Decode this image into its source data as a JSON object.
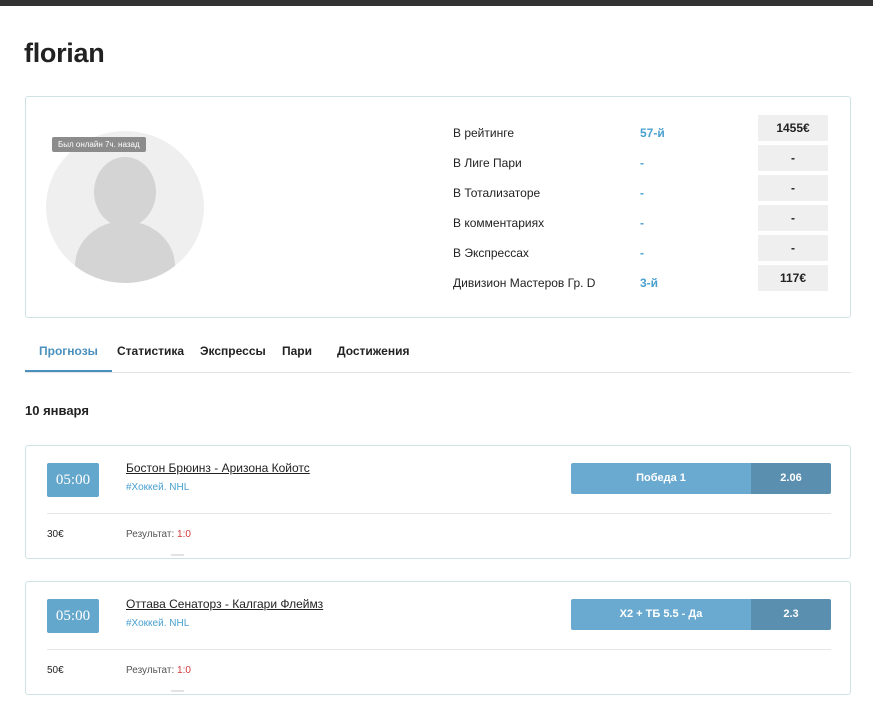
{
  "profile": {
    "username": "florian",
    "online_status": "Был онлайн 7ч. назад",
    "stats": [
      {
        "label": "В рейтинге",
        "rank": "57-й",
        "value": "1455€"
      },
      {
        "label": "В Лиге Пари",
        "rank": "-",
        "value": "-"
      },
      {
        "label": "В Тотализаторе",
        "rank": "-",
        "value": "-"
      },
      {
        "label": "В комментариях",
        "rank": "-",
        "value": "-"
      },
      {
        "label": "В Экспрессах",
        "rank": "-",
        "value": "-"
      },
      {
        "label": "Дивизион Мастеров Гр. D",
        "rank": "3-й",
        "value": "117€"
      }
    ]
  },
  "tabs": [
    {
      "label": "Прогнозы",
      "active": true
    },
    {
      "label": "Статистика",
      "active": false
    },
    {
      "label": "Экспрессы",
      "active": false
    },
    {
      "label": "Пари",
      "active": false
    },
    {
      "label": "Достижения",
      "active": false
    }
  ],
  "date_heading": "10 января",
  "matches": [
    {
      "time": "05:00",
      "title": "Бостон Брюинз - Аризона Койотс",
      "tag": "#Хоккей. NHL",
      "bet": "Победа 1",
      "odds": "2.06",
      "stake": "30€",
      "result_label": "Результат:",
      "result_score": "1:0"
    },
    {
      "time": "05:00",
      "title": "Оттава Сенаторз - Калгари Флеймз",
      "tag": "#Хоккей. NHL",
      "bet": "Х2 + ТБ 5.5 - Да",
      "odds": "2.3",
      "stake": "50€",
      "result_label": "Результат:",
      "result_score": "1:0"
    }
  ],
  "colors": {
    "accent": "#4aa0cf",
    "tab_active": "#4a8fbd",
    "time_box": "#64a7cc",
    "bet_name_bg": "#6aaad0",
    "bet_odds_bg": "#5a8fb0",
    "result_score": "#d23a3a",
    "card_border": "#cfe3e6"
  }
}
